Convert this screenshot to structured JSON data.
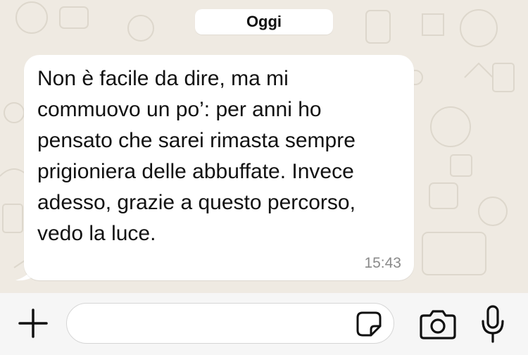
{
  "chat": {
    "date_label": "Oggi",
    "messages": [
      {
        "direction": "incoming",
        "text": "Non è facile da dire, ma mi commuovo un po’: per anni ho pensato che sarei rimasta sempre prigioniera delle abbuffate. Invece adesso, grazie a questo percorso, vedo la luce.",
        "time": "15:43"
      }
    ]
  },
  "composer": {
    "placeholder": "",
    "value": ""
  },
  "icons": {
    "attach": "plus-icon",
    "sticker": "sticker-icon",
    "camera": "camera-icon",
    "microphone": "microphone-icon"
  },
  "colors": {
    "chat_background": "#efeae2",
    "bubble_incoming": "#ffffff",
    "input_bar": "#f6f6f6",
    "timestamp": "#8a8a8a"
  }
}
